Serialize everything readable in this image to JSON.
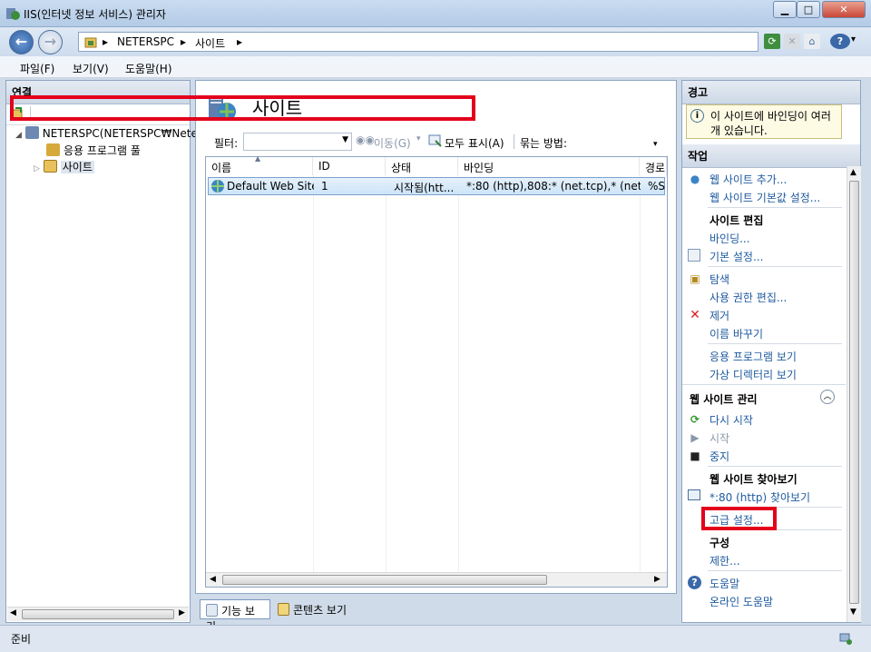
{
  "window": {
    "title": "IIS(인터넷 정보 서비스) 관리자"
  },
  "address": {
    "crumb1": "NETERSPC",
    "crumb2": "사이트",
    "sep": "▸"
  },
  "menu": {
    "file": "파일(F)",
    "view": "보기(V)",
    "help": "도움말(H)"
  },
  "connections": {
    "header": "연결",
    "server": "NETERSPC(NETERSPC₩Neter",
    "app_pools": "응용 프로그램 풀",
    "sites": "사이트"
  },
  "main": {
    "title": "사이트",
    "filter_label": "필터:",
    "go_label": "이동(G)",
    "show_all_label": "모두 표시(A)",
    "group_by_label": "묶는 방법:",
    "columns": [
      "이름",
      "ID",
      "상태",
      "바인딩",
      "경로"
    ],
    "rows": [
      {
        "name": "Default Web Site",
        "id": "1",
        "status": "시작됨(htt...",
        "binding": "*:80 (http),808:* (net.tcp),* (net....",
        "path": "%S"
      }
    ],
    "tab_features": "기능 보기",
    "tab_content": "콘텐츠 보기"
  },
  "actions": {
    "alerts_header": "경고",
    "alert_text_1": "이 사이트에 바인딩이 여러",
    "alert_text_2": "개 있습니다.",
    "actions_header": "작업",
    "add_site": "웹 사이트 추가...",
    "site_defaults": "웹 사이트 기본값 설정...",
    "edit_site_header": "사이트 편집",
    "bindings": "바인딩...",
    "basic_settings": "기본 설정...",
    "explore": "탐색",
    "edit_permissions": "사용 권한 편집...",
    "remove": "제거",
    "rename": "이름 바꾸기",
    "view_apps": "응용 프로그램 보기",
    "view_vdirs": "가상 디렉터리 보기",
    "manage_header": "웹 사이트 관리",
    "restart": "다시 시작",
    "start": "시작",
    "stop": "중지",
    "browse_header": "웹 사이트 찾아보기",
    "browse_80": "*:80 (http) 찾아보기",
    "advanced": "고급 설정...",
    "config_header": "구성",
    "limits": "제한...",
    "help": "도움말",
    "online_help": "온라인 도움말"
  },
  "status": {
    "text": "준비"
  },
  "colors": {
    "highlight": "#e3001b",
    "link": "#1e5a9e"
  }
}
